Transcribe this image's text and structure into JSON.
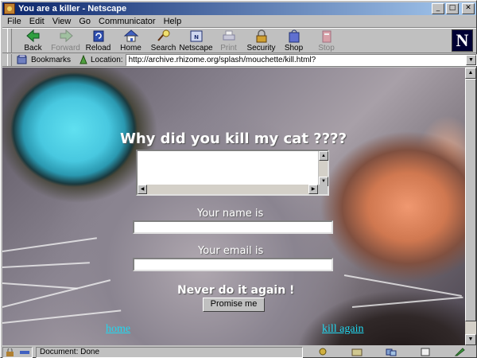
{
  "window": {
    "title": "You are a killer - Netscape"
  },
  "menu": [
    "File",
    "Edit",
    "View",
    "Go",
    "Communicator",
    "Help"
  ],
  "toolbar": [
    {
      "label": "Back",
      "icon": "back-icon",
      "enabled": true
    },
    {
      "label": "Forward",
      "icon": "forward-icon",
      "enabled": false
    },
    {
      "label": "Reload",
      "icon": "reload-icon",
      "enabled": true
    },
    {
      "label": "Home",
      "icon": "home-icon",
      "enabled": true
    },
    {
      "label": "Search",
      "icon": "search-icon",
      "enabled": true
    },
    {
      "label": "Netscape",
      "icon": "netscape-icon",
      "enabled": true
    },
    {
      "label": "Print",
      "icon": "print-icon",
      "enabled": false
    },
    {
      "label": "Security",
      "icon": "security-icon",
      "enabled": true
    },
    {
      "label": "Shop",
      "icon": "shop-icon",
      "enabled": true
    },
    {
      "label": "Stop",
      "icon": "stop-icon",
      "enabled": false
    }
  ],
  "brand_logo": "N",
  "location": {
    "bookmarks_label": "Bookmarks",
    "location_label": "Location:",
    "url": "http://archive.rhizome.org/splash/mouchette/kill.html?"
  },
  "page": {
    "heading": "Why did you kill my cat ????",
    "name_label": "Your name is",
    "email_label": "Your email is",
    "never_text": "Never do it again !",
    "promise_button": "Promise me",
    "home_link": "home",
    "kill_link": "kill again"
  },
  "status": {
    "text": "Document: Done"
  },
  "colors": {
    "title_bar": "#0a246a",
    "link": "#20d8f0"
  }
}
